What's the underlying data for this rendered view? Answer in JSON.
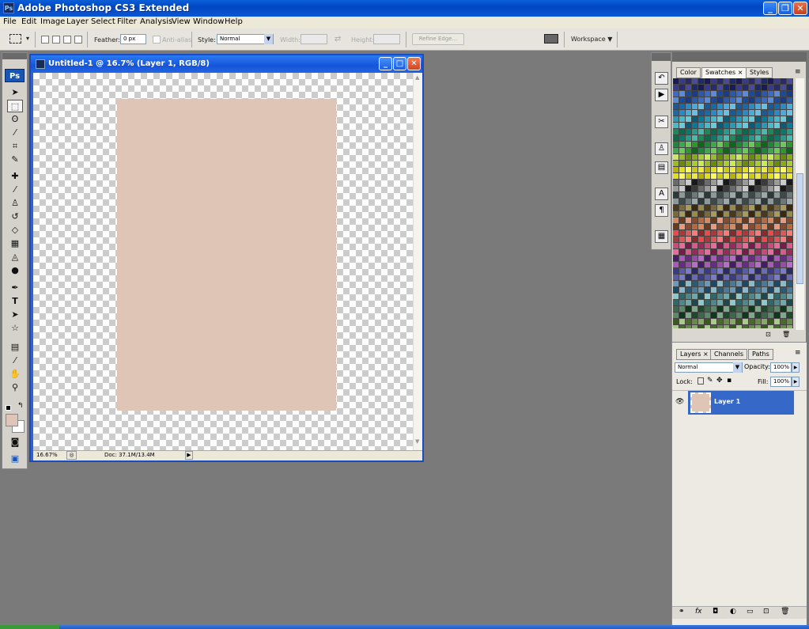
{
  "app": {
    "title": "Adobe Photoshop CS3 Extended",
    "icon_text": "Ps",
    "window_buttons": [
      "minimize-icon",
      "maximize-icon",
      "close-icon"
    ]
  },
  "menu": [
    "File",
    "Edit",
    "Image",
    "Layer",
    "Select",
    "Filter",
    "Analysis",
    "View",
    "Window",
    "Help"
  ],
  "options_bar": {
    "feather_label": "Feather:",
    "feather_value": "0 px",
    "antialias_label": "Anti-alias",
    "style_label": "Style:",
    "style_value": "Normal",
    "width_label": "Width:",
    "height_label": "Height:",
    "refine_edge_label": "Refine Edge...",
    "workspace_label": "Workspace ▼"
  },
  "toolbox": {
    "ps_label": "Ps",
    "tools": [
      "move-tool-icon",
      "marquee-tool-icon",
      "lasso-tool-icon",
      "magic-wand-icon",
      "crop-tool-icon",
      "slice-tool-icon",
      "healing-brush-icon",
      "brush-tool-icon",
      "clone-stamp-icon",
      "history-brush-icon",
      "eraser-icon",
      "gradient-icon",
      "blur-icon",
      "dodge-icon",
      "pen-tool-icon",
      "type-tool-icon",
      "path-selection-icon",
      "shape-tool-icon",
      "notes-icon",
      "eyedropper-icon",
      "hand-tool-icon",
      "zoom-tool-icon"
    ],
    "foreground_color": "#dfc5b6",
    "background_color": "#ffffff"
  },
  "document": {
    "title": "Untitled-1 @ 16.7% (Layer 1, RGB/8)",
    "zoom": "16.67%",
    "doc_info": "Doc: 37.1M/13.4M",
    "canvas_color": "#dfc5b6"
  },
  "swatches_panel": {
    "tabs": [
      "Color",
      "Swatches ×",
      "Styles"
    ],
    "active_tab": 1
  },
  "layers_panel": {
    "tabs": [
      "Layers ×",
      "Channels",
      "Paths"
    ],
    "blend_mode": "Normal",
    "opacity_label": "Opacity:",
    "opacity_value": "100%",
    "lock_label": "Lock:",
    "fill_label": "Fill:",
    "fill_value": "100%",
    "layers": [
      {
        "name": "Layer 1",
        "visible": true,
        "selected": true
      }
    ]
  }
}
